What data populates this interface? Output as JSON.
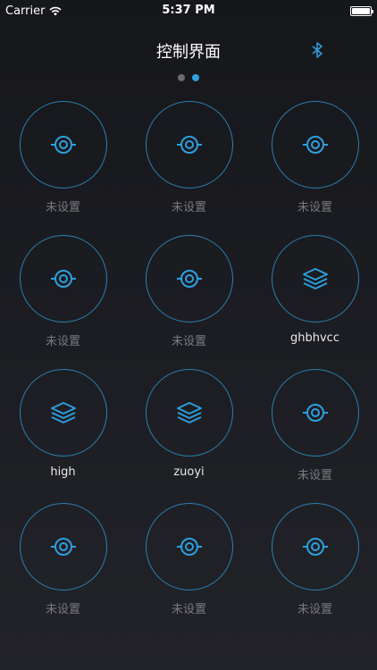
{
  "status_bar": {
    "carrier": "Carrier",
    "time": "5:37 PM",
    "battery_level": 1.0
  },
  "nav": {
    "title": "控制界面",
    "right_icon": "bluetooth-icon"
  },
  "pager": {
    "pages": 2,
    "current": 2
  },
  "colors": {
    "accent": "#2d9fe0",
    "ring": "#2a7fb2",
    "muted_label": "#7a7b80"
  },
  "buttons": [
    {
      "icon": "target-icon",
      "label": "未设置",
      "set": false
    },
    {
      "icon": "target-icon",
      "label": "未设置",
      "set": false
    },
    {
      "icon": "target-icon",
      "label": "未设置",
      "set": false
    },
    {
      "icon": "target-icon",
      "label": "未设置",
      "set": false
    },
    {
      "icon": "target-icon",
      "label": "未设置",
      "set": false
    },
    {
      "icon": "layers-icon",
      "label": "ghbhvcc",
      "set": true
    },
    {
      "icon": "layers-icon",
      "label": "high",
      "set": true
    },
    {
      "icon": "layers-icon",
      "label": "zuoyi",
      "set": true
    },
    {
      "icon": "target-icon",
      "label": "未设置",
      "set": false
    },
    {
      "icon": "target-icon",
      "label": "未设置",
      "set": false
    },
    {
      "icon": "target-icon",
      "label": "未设置",
      "set": false
    },
    {
      "icon": "target-icon",
      "label": "未设置",
      "set": false
    }
  ]
}
